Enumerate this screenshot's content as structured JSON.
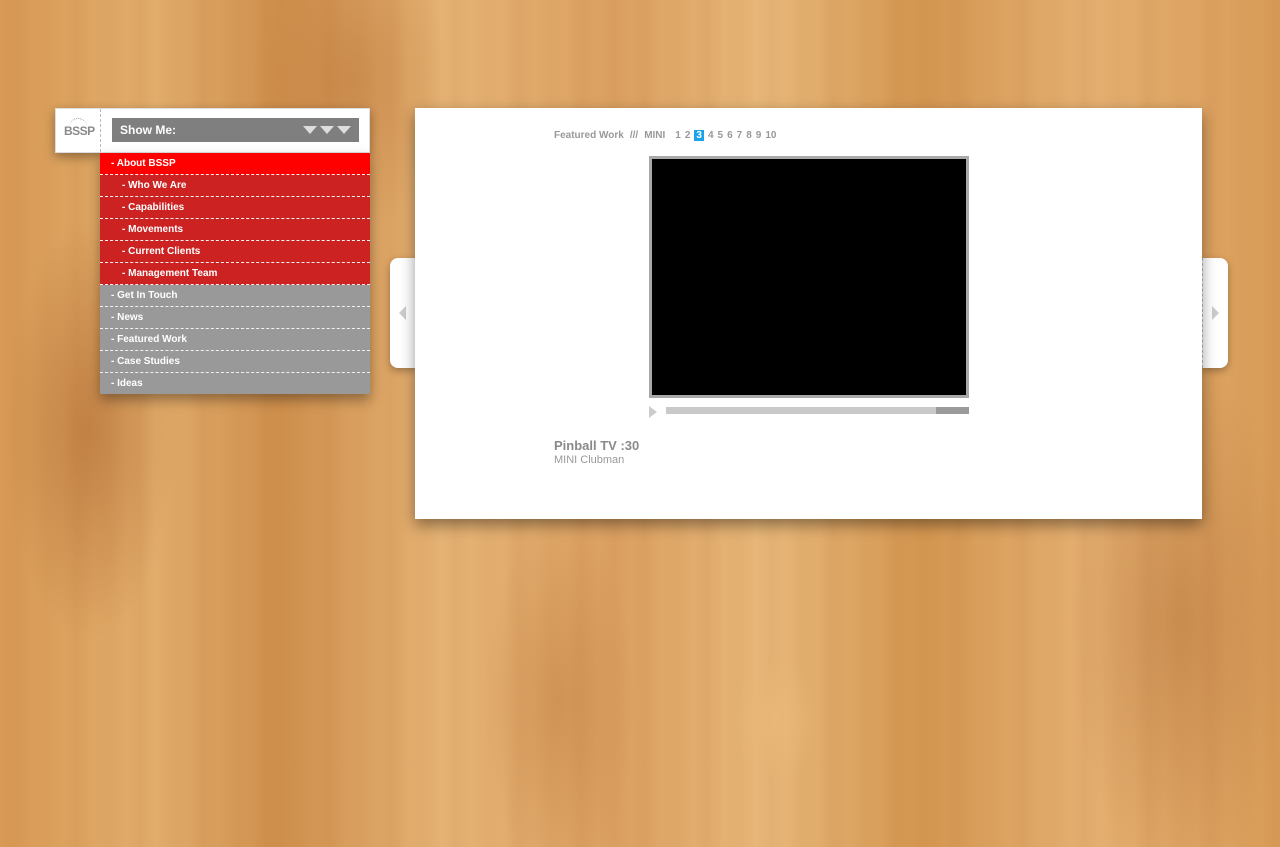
{
  "header": {
    "logo_text": "BSSP",
    "show_me_label": "Show Me:",
    "dropdown_icon": "triple-chevron-down-icon"
  },
  "menu": {
    "items": [
      {
        "label": "- About BSSP",
        "state": "active"
      },
      {
        "label": "- Who We Are",
        "state": "sub"
      },
      {
        "label": "- Capabilities",
        "state": "sub"
      },
      {
        "label": "- Movements",
        "state": "sub"
      },
      {
        "label": "- Current Clients",
        "state": "sub"
      },
      {
        "label": "- Management Team",
        "state": "sub"
      },
      {
        "label": "- Get In Touch",
        "state": "main"
      },
      {
        "label": "- News",
        "state": "main"
      },
      {
        "label": "- Featured Work",
        "state": "main"
      },
      {
        "label": "- Case Studies",
        "state": "main"
      },
      {
        "label": "- Ideas",
        "state": "main"
      }
    ],
    "colors": {
      "active": "#ff0000",
      "sub": "#cc2222",
      "main": "#999999"
    }
  },
  "content": {
    "breadcrumb": {
      "section": "Featured Work",
      "separator": "///",
      "client": "MINI",
      "pages": [
        "1",
        "2",
        "3",
        "4",
        "5",
        "6",
        "7",
        "8",
        "9",
        "10"
      ],
      "current_page": "3",
      "current_color": "#1aa3e8"
    },
    "video": {
      "progress_fraction": 0.11
    },
    "work": {
      "title": "Pinball TV :30",
      "subtitle": "MINI Clubman"
    }
  },
  "nav": {
    "prev_icon": "chevron-left-icon",
    "next_icon": "chevron-right-icon"
  }
}
